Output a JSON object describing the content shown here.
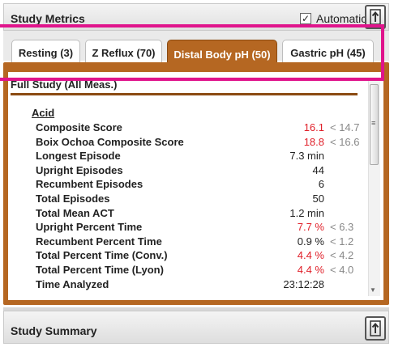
{
  "panel": {
    "title": "Study Metrics",
    "automatic_label": "Automatic",
    "automatic_checked": "✓"
  },
  "tabs": [
    {
      "label": "Resting (3)",
      "active": false
    },
    {
      "label": "Z Reflux (70)",
      "active": false
    },
    {
      "label": "Distal Body pH (50)",
      "active": true
    },
    {
      "label": "Gastric pH (45)",
      "active": false
    }
  ],
  "section": {
    "title": "Full Study (All Meas.)",
    "group": "Acid"
  },
  "metrics": [
    {
      "name": "Composite Score",
      "value": "16.1",
      "value_color": "red",
      "ref": "< 14.7"
    },
    {
      "name": "Boix Ochoa Composite Score",
      "value": "18.8",
      "value_color": "red",
      "ref": "< 16.6"
    },
    {
      "name": "Longest Episode",
      "value": "7.3 min",
      "value_color": "normal",
      "ref": ""
    },
    {
      "name": "Upright Episodes",
      "value": "44",
      "value_color": "normal",
      "ref": ""
    },
    {
      "name": "Recumbent Episodes",
      "value": "6",
      "value_color": "normal",
      "ref": ""
    },
    {
      "name": "Total Episodes",
      "value": "50",
      "value_color": "normal",
      "ref": ""
    },
    {
      "name": "Total Mean ACT",
      "value": "1.2 min",
      "value_color": "normal",
      "ref": ""
    },
    {
      "name": "Upright Percent Time",
      "value": "7.7 %",
      "value_color": "red",
      "ref": "< 6.3"
    },
    {
      "name": "Recumbent Percent Time",
      "value": "0.9 %",
      "value_color": "normal",
      "ref": "< 1.2"
    },
    {
      "name": "Total Percent Time (Conv.)",
      "value": "4.4 %",
      "value_color": "red",
      "ref": "< 4.2"
    },
    {
      "name": "Total Percent Time (Lyon)",
      "value": "4.4 %",
      "value_color": "red",
      "ref": "< 4.0"
    },
    {
      "name": "Time Analyzed",
      "value": "23:12:28",
      "value_color": "normal",
      "ref": ""
    }
  ],
  "summary": {
    "title": "Study Summary"
  },
  "colors": {
    "tab_active": "#b56722",
    "value_red": "#e0202a",
    "highlight": "#e0148c"
  },
  "icons": {
    "expand": "expand-icon",
    "scroll_grip": "grip-icon",
    "scroll_down": "chevron-down-icon"
  }
}
